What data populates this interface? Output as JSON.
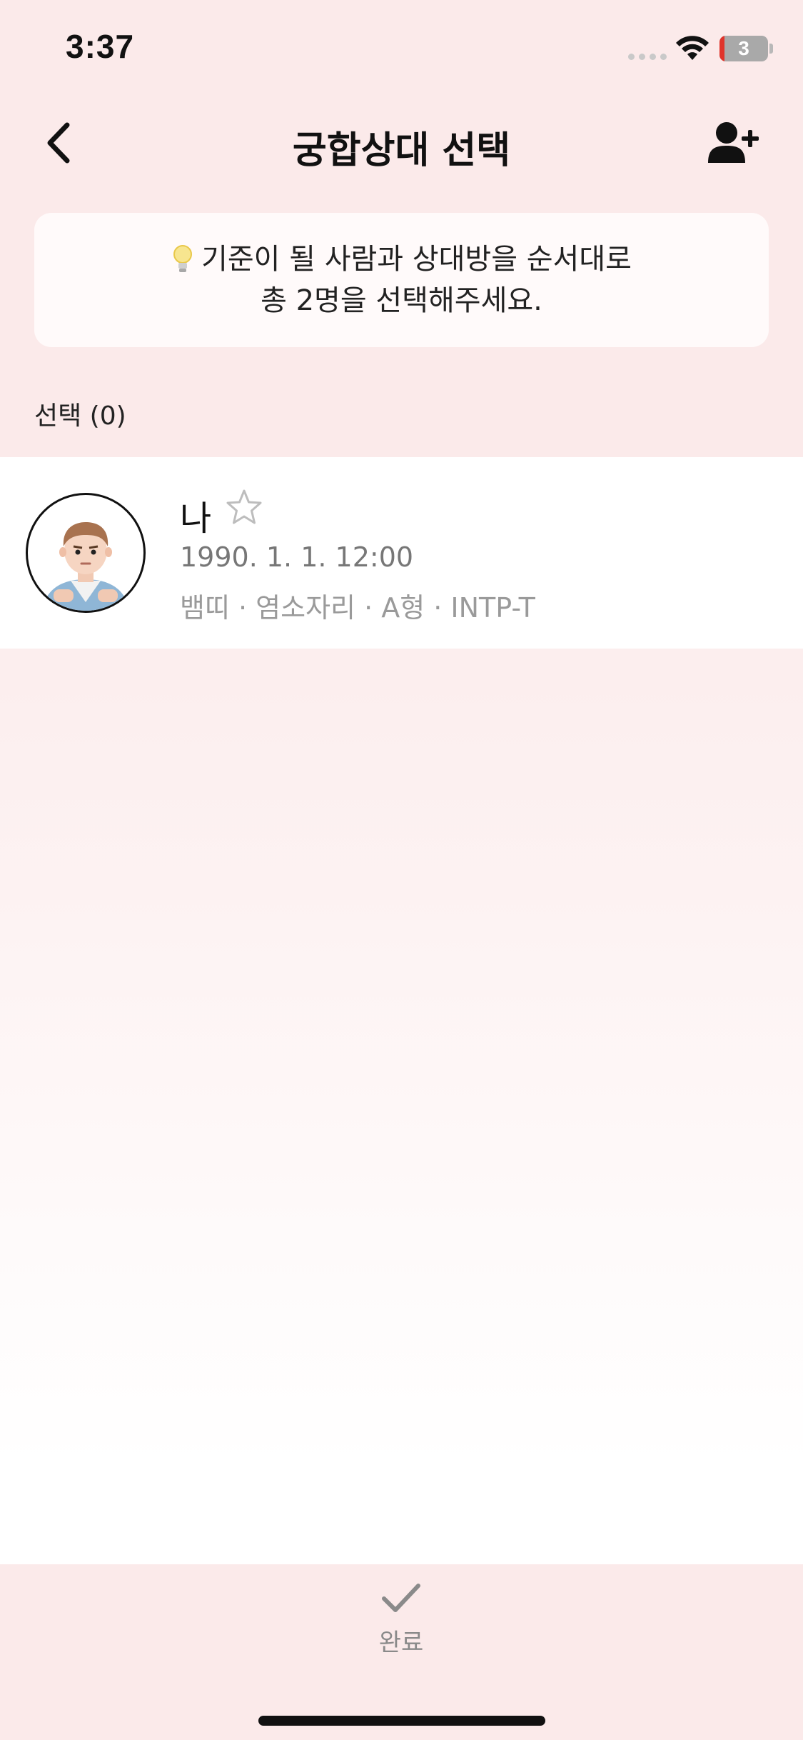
{
  "status_bar": {
    "time": "3:37",
    "battery_level": "3",
    "icons": [
      "signal-dots-icon",
      "wifi-icon",
      "battery-icon"
    ]
  },
  "header": {
    "title": "궁합상대 선택",
    "back_icon": "chevron-left-icon",
    "add_icon": "add-person-icon"
  },
  "notice": {
    "icon": "lightbulb-icon",
    "line1": "기준이 될 사람과 상대방을 순서대로",
    "line2": "총 2명을 선택해주세요."
  },
  "selection": {
    "label": "선택 (0)"
  },
  "profiles": [
    {
      "name": "나",
      "birth": "1990. 1. 1. 12:00",
      "tags": "뱀띠 · 염소자리 · A형 · INTP-T",
      "favorite": false
    }
  ],
  "bottom_bar": {
    "done_label": "완료",
    "done_icon": "check-icon"
  },
  "colors": {
    "background": "#fbeaea",
    "card": "#fffafa",
    "text_primary": "#111111",
    "text_secondary": "#777777"
  }
}
